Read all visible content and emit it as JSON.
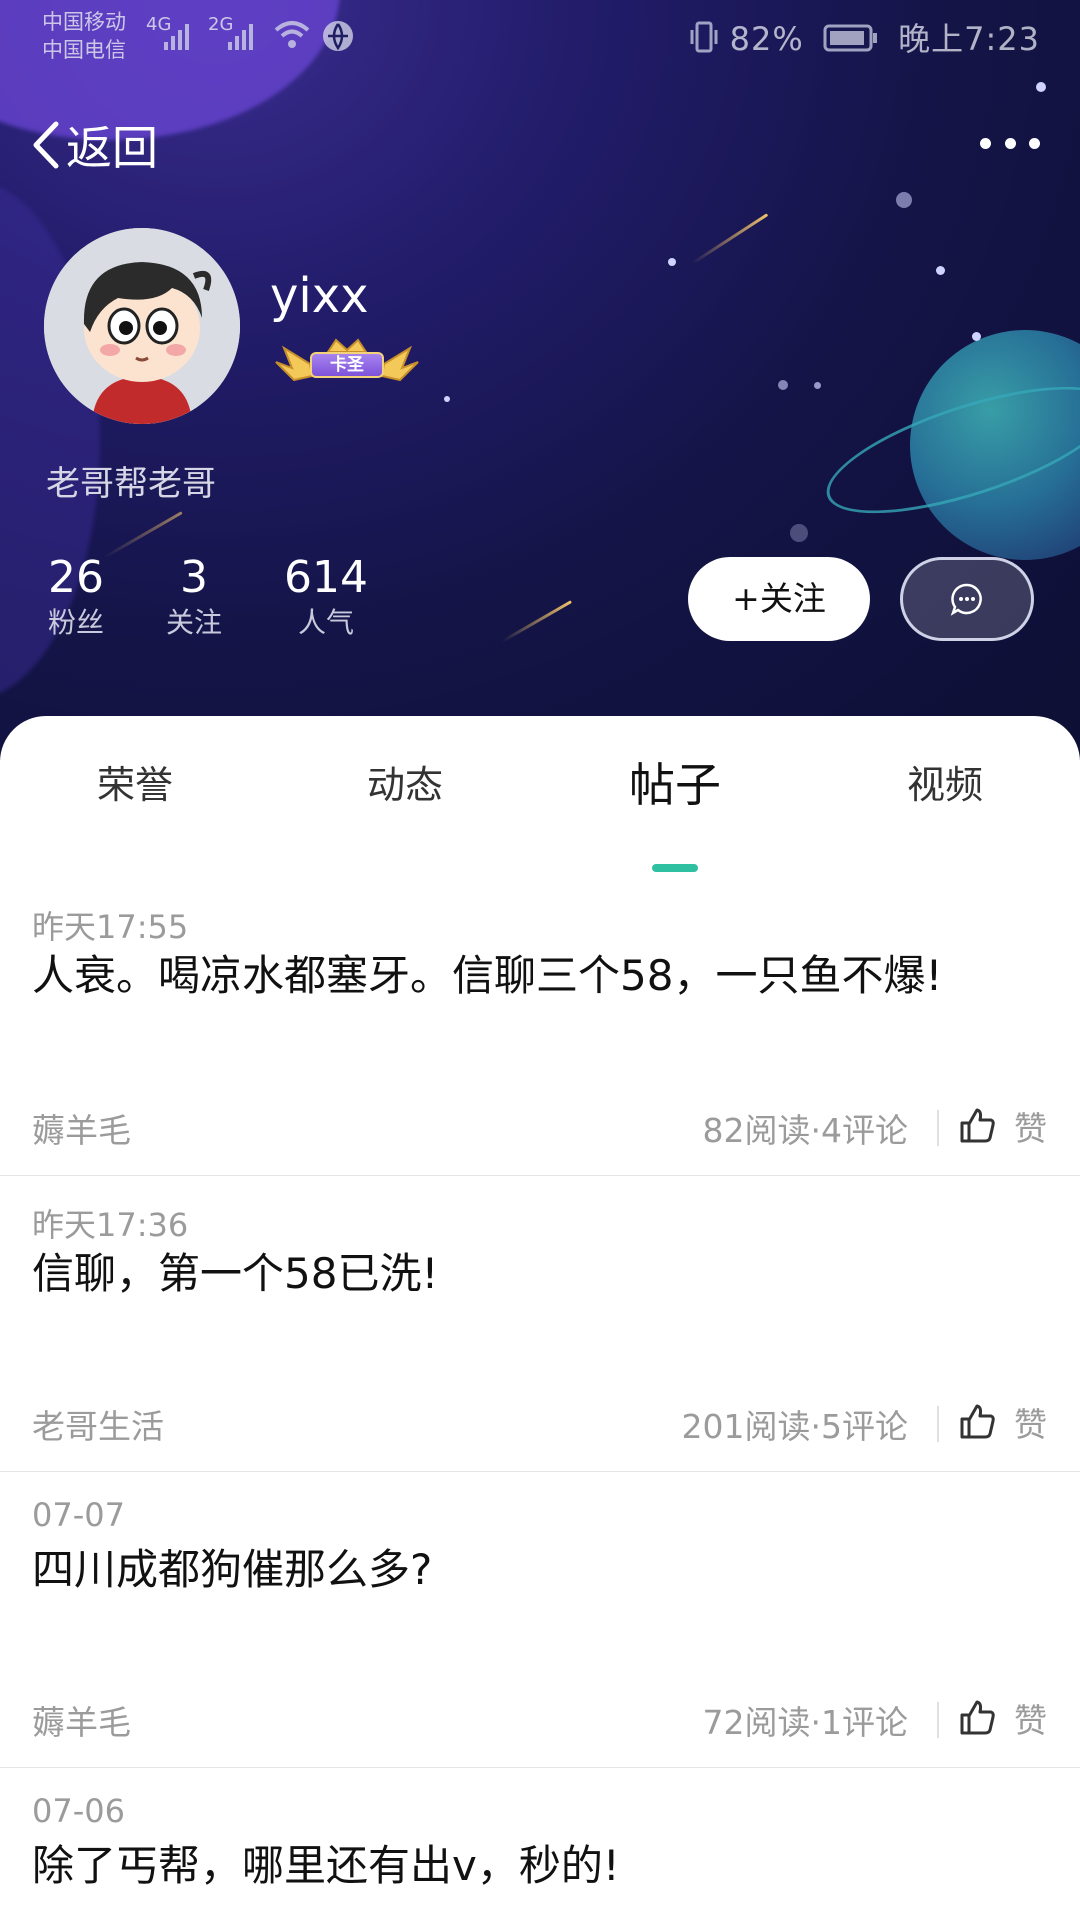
{
  "status_bar": {
    "carrier1": "中国移动",
    "carrier2": "中国电信",
    "net1": "4G",
    "net2": "2G",
    "battery": "82%",
    "time": "晚上7:23"
  },
  "nav": {
    "back_label": "返回"
  },
  "profile": {
    "username": "yixx",
    "badge_label": "卡圣",
    "motto": "老哥帮老哥",
    "stats": [
      {
        "value": "26",
        "label": "粉丝"
      },
      {
        "value": "3",
        "label": "关注"
      },
      {
        "value": "614",
        "label": "人气"
      }
    ],
    "follow_label": "+关注"
  },
  "tabs": [
    {
      "label": "荣誉",
      "active": false
    },
    {
      "label": "动态",
      "active": false
    },
    {
      "label": "帖子",
      "active": true
    },
    {
      "label": "视频",
      "active": false
    }
  ],
  "posts": [
    {
      "date": "昨天17:55",
      "title": "人衰。喝凉水都塞牙。信聊三个58，一只鱼不爆!",
      "circle": "薅羊毛",
      "meta": "82阅读·4评论",
      "like_label": "赞"
    },
    {
      "date": "昨天17:36",
      "title": "信聊，第一个58已洗!",
      "circle": "老哥生活",
      "meta": "201阅读·5评论",
      "like_label": "赞"
    },
    {
      "date": "07-07",
      "title": "四川成都狗催那么多?",
      "circle": "薅羊毛",
      "meta": "72阅读·1评论",
      "like_label": "赞"
    },
    {
      "date": "07-06",
      "title": "除了丐帮，哪里还有出v，秒的!",
      "circle": "",
      "meta": "",
      "like_label": ""
    }
  ],
  "colors": {
    "accent": "#2fc0a1",
    "hero_dark": "#141447",
    "muted_text": "#9b9b9b"
  }
}
